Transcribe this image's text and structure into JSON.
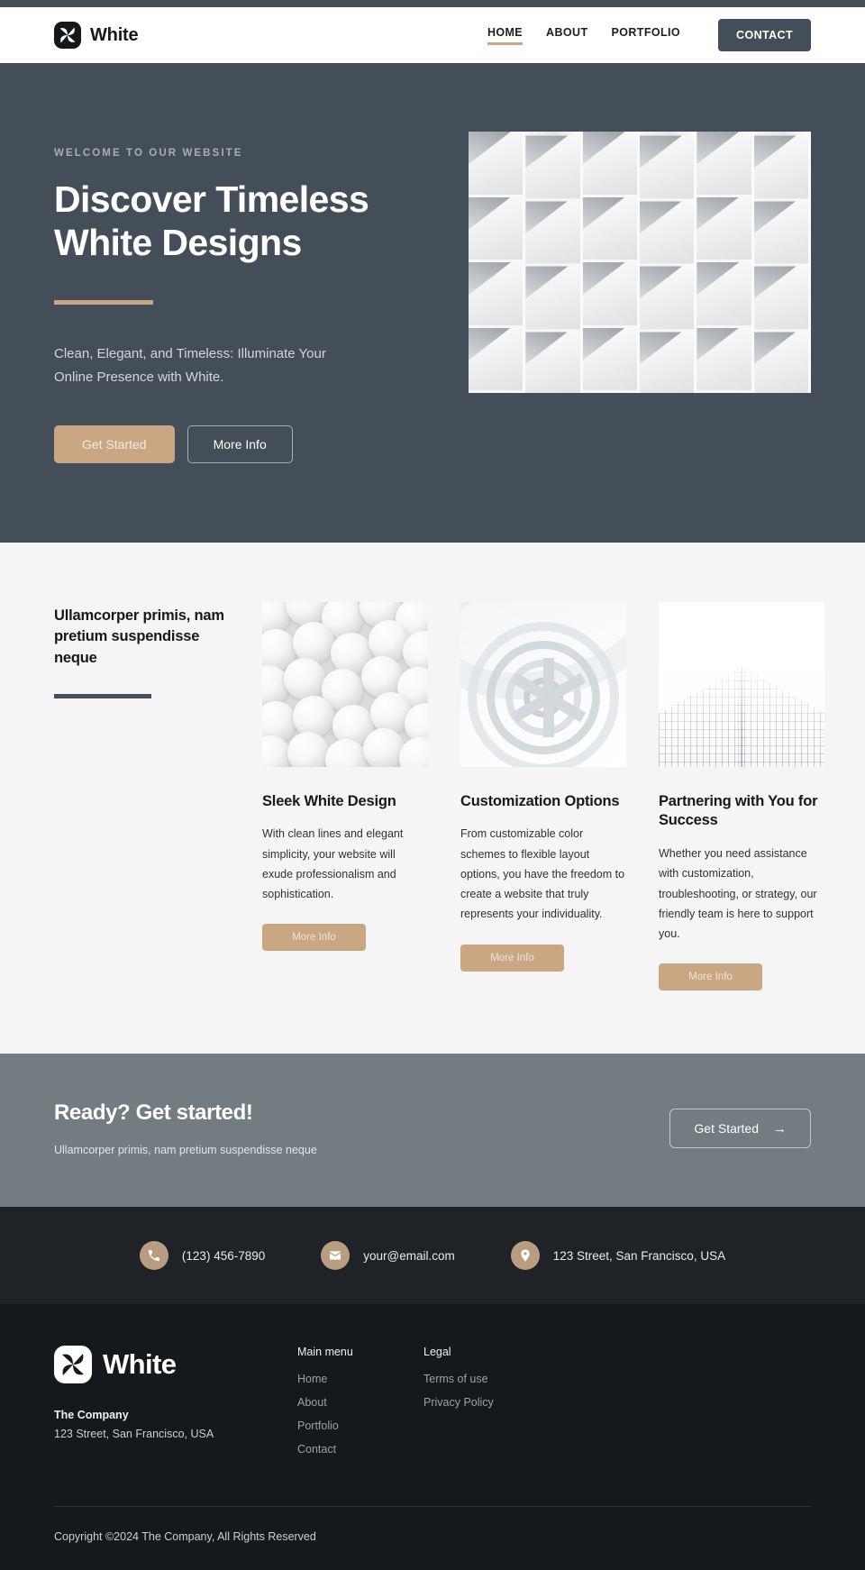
{
  "header": {
    "brand": "White",
    "logo_icon": "pinwheel-logo-icon",
    "nav": [
      {
        "label": "HOME",
        "active": true
      },
      {
        "label": "ABOUT",
        "active": false
      },
      {
        "label": "PORTFOLIO",
        "active": false
      }
    ],
    "contact_button": "CONTACT"
  },
  "hero": {
    "eyebrow": "WELCOME TO OUR WEBSITE",
    "title": "Discover Timeless White Designs",
    "subtitle": "Clean, Elegant, and Timeless: Illuminate Your Online Presence with White.",
    "primary_button": "Get Started",
    "secondary_button": "More Info",
    "image_alt": "white-architectural-facade-photo"
  },
  "features": {
    "heading": "Ullamcorper primis, nam pretium suspendisse neque",
    "cards": [
      {
        "title": "Sleek White Design",
        "text": "With clean lines and elegant simplicity, your website will exude professionalism and sophistication.",
        "button": "More Info",
        "image_alt": "white-spheres-grid-photo"
      },
      {
        "title": "Customization Options",
        "text": "From customizable color schemes to flexible layout options, you have the freedom to create a website that truly represents your individuality.",
        "button": "More Info",
        "image_alt": "white-spiral-staircase-photo"
      },
      {
        "title": "Partnering with You for Success",
        "text": "Whether you need assistance with customization, troubleshooting, or strategy, our friendly team is here to support you.",
        "button": "More Info",
        "image_alt": "white-glass-skyscraper-photo"
      }
    ]
  },
  "cta": {
    "title": "Ready? Get started!",
    "subtitle": "Ullamcorper primis, nam pretium suspendisse neque",
    "button": "Get Started",
    "button_arrow": "→"
  },
  "contact": {
    "phone": "(123) 456-7890",
    "email": "your@email.com",
    "address": "123 Street, San Francisco, USA",
    "phone_icon": "phone-icon",
    "email_icon": "envelope-icon",
    "address_icon": "location-pin-icon"
  },
  "footer": {
    "brand": "White",
    "company": "The Company",
    "address": "123 Street, San Francisco, USA",
    "menu_title": "Main menu",
    "menu_links": [
      "Home",
      "About",
      "Portfolio",
      "Contact"
    ],
    "legal_title": "Legal",
    "legal_links": [
      "Terms of use",
      "Privacy Policy"
    ],
    "copyright": "Copyright ©2024 The Company, All Rights Reserved"
  },
  "colors": {
    "accent": "#c9a782",
    "dark_slate": "#444e58",
    "cta_gray": "#737c80",
    "contact_bar": "#1f2226",
    "footer": "#16191b",
    "features_bg": "#f5f5f5"
  }
}
